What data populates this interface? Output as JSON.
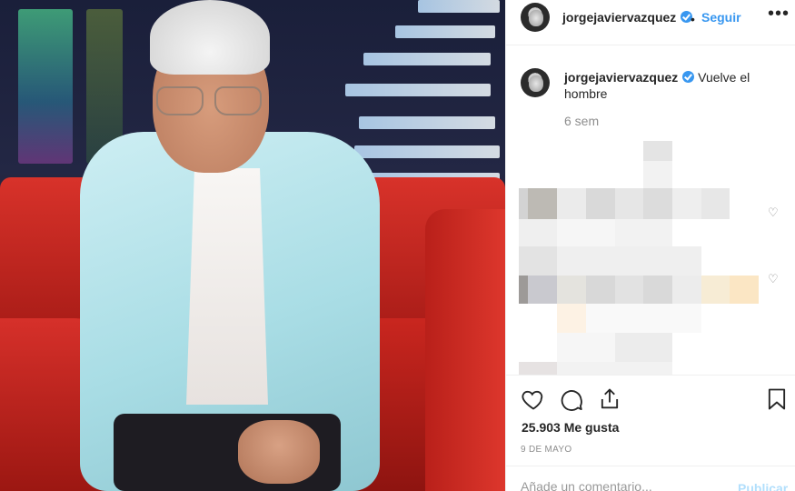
{
  "post": {
    "username": "jorgejaviervazquez",
    "verified": true,
    "follow_label": "Seguir",
    "separator": "•",
    "more_icon": "more-horizontal-icon",
    "caption_text": " Vuelve el hombre",
    "time_ago": "6 sem",
    "likes_label": "25.903 Me gusta",
    "date": "9 DE MAYO",
    "comment_placeholder": "Añade un comentario...",
    "publish_label": "Publicar"
  },
  "icons": {
    "like": "heart-icon",
    "comment": "comment-icon",
    "share": "share-icon",
    "save": "bookmark-icon"
  },
  "colors": {
    "accent": "#3897f0",
    "muted": "#8e8e8e",
    "publish_disabled": "#b2dffc"
  }
}
